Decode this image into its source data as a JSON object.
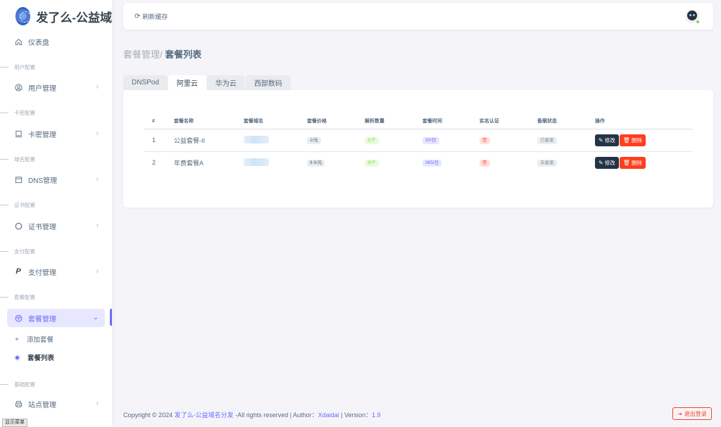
{
  "brand": {
    "name": "发了么-公益域"
  },
  "sidebar": {
    "items": [
      {
        "key": "dashboard",
        "label": "仪表盘",
        "icon": "home-icon"
      },
      {
        "key": "users",
        "label": "用户管理",
        "icon": "user-circle-icon"
      },
      {
        "key": "cards",
        "label": "卡密管理",
        "icon": "monitor-icon"
      },
      {
        "key": "dns",
        "label": "DNS管理",
        "icon": "calendar-icon"
      },
      {
        "key": "cert",
        "label": "证书管理",
        "icon": "circle-icon"
      },
      {
        "key": "pay",
        "label": "支付管理",
        "icon": "paypal-icon"
      },
      {
        "key": "plans",
        "label": "套餐管理",
        "icon": "package-icon"
      },
      {
        "key": "site",
        "label": "站点管理",
        "icon": "printer-icon"
      }
    ],
    "headers": [
      "用户配置",
      "卡密配置",
      "域名配置",
      "证书配置",
      "支付配置",
      "套餐配置",
      "基础配置"
    ],
    "sub_items": [
      {
        "label": "添加套餐"
      },
      {
        "label": "套餐列表"
      }
    ],
    "show_menu": "显示菜单"
  },
  "topbar": {
    "refresh_label": "刷新缓存"
  },
  "breadcrumb": {
    "parent": "套餐管理/",
    "current": "套餐列表"
  },
  "tabs": [
    {
      "label": "DNSPod"
    },
    {
      "label": "阿里云"
    },
    {
      "label": "华为云"
    },
    {
      "label": "西部数码"
    }
  ],
  "table": {
    "headers": [
      "#",
      "套餐名称",
      "套餐域名",
      "套餐价格",
      "解析数量",
      "套餐时间",
      "实名认证",
      "备案状态",
      "操作"
    ],
    "rows": [
      {
        "id": "1",
        "name": "公益套餐-II",
        "price": "1/元",
        "count": "1/个",
        "time": "30/日",
        "realname": "否",
        "icp": "已备案"
      },
      {
        "id": "2",
        "name": "年费套餐A",
        "price": "9.9/元",
        "count": "3/个",
        "time": "365/日",
        "realname": "否",
        "icp": "未备案"
      }
    ],
    "edit_label": "修改",
    "delete_label": "删除"
  },
  "footer": {
    "prefix": "Copyright © 2024 ",
    "site": "发了么-公益域名分发",
    "middle": " -All rights reserved | Author：",
    "author": "Xdaidai",
    "version_prefix": " | Version：",
    "version": "1.9"
  },
  "logout_label": "退出登录",
  "colors": {
    "accent": "#696cff",
    "danger": "#ff3e1d",
    "dark": "#233446"
  }
}
